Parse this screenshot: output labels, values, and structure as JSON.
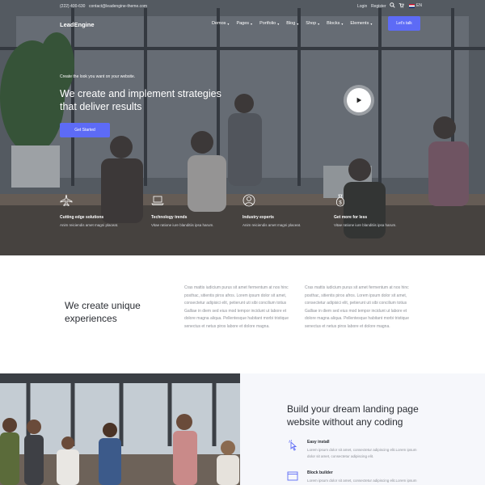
{
  "topbar": {
    "phone": "(222) 400-630",
    "email": "contact@leadengine-theme.com",
    "login": "Login",
    "register": "Register",
    "search_icon": "search-icon",
    "cart_icon": "cart-icon",
    "language": "EN"
  },
  "navbar": {
    "logo": "LeadEngine",
    "items": [
      {
        "label": "Demos"
      },
      {
        "label": "Pages"
      },
      {
        "label": "Portfolio"
      },
      {
        "label": "Blog"
      },
      {
        "label": "Shop"
      },
      {
        "label": "Blocks"
      },
      {
        "label": "Elements"
      }
    ],
    "cta": "Let's talk"
  },
  "hero": {
    "subtitle": "Create the look you want on your website.",
    "title": "We create and implement strategies that deliver results",
    "button": "Get Started",
    "features": [
      {
        "icon": "airplane-icon",
        "title": "Cutting edge solutions",
        "text": "Anim reiciendis amet magni placeat."
      },
      {
        "icon": "laptop-icon",
        "title": "Technology trends",
        "text": "Vitae ratione iure blanditiis ipsa harum."
      },
      {
        "icon": "user-icon",
        "title": "Industry experts",
        "text": "Anim reiciendis amet magni placeat."
      },
      {
        "icon": "money-bag-icon",
        "title": "Get more for less",
        "text": "Vitae ratione iure blanditiis ipsa harum."
      }
    ]
  },
  "about": {
    "title": "We create unique experiences",
    "col1": "Cras mattis iudicium purus sit amet fermentum at nos hinc posthac, sitientis piros afros. Lorem ipsum dolor sit amet, consectetur adipisici elit, petierunt uti sibi concilium totius Galliae in diem sed eius mod tempor incidunt ut labore et dolore magna aliqua. Pellentesque habitant morbi tristique senectus et netus piros labore et dolore magna.",
    "col2": "Cras mattis iudicium purus sit amet fermentum at nos hinc posthac, sitientis piros afros. Lorem ipsum dolor sit amet, consectetur adipisici elit, petierunt uti sibi concilium totius Galliae in diem sed eius mod tempor incidunt ut labore et dolore magna aliqua. Pellentesque habitant morbi tristique senectus et netus piros labore et dolore magna."
  },
  "build": {
    "title": "Build your dream landing page website without any coding",
    "features": [
      {
        "icon": "pointer-click-icon",
        "title": "Easy install",
        "text": "Lorem ipsum dolor sit amet, consectetur adipiscing elit.Lorem ipsum dolor sit amet, consectetur adipiscing elit."
      },
      {
        "icon": "browser-window-icon",
        "title": "Block builder",
        "text": "Lorem ipsum dolor sit amet, consectetur adipiscing elit.Lorem ipsum dolor sit amet, consectetur adipiscing elit."
      }
    ]
  },
  "colors": {
    "accent": "#5d6bf6",
    "heading": "#2a2d33",
    "body_text": "#8d9097",
    "section_bg": "#f6f7fb"
  }
}
